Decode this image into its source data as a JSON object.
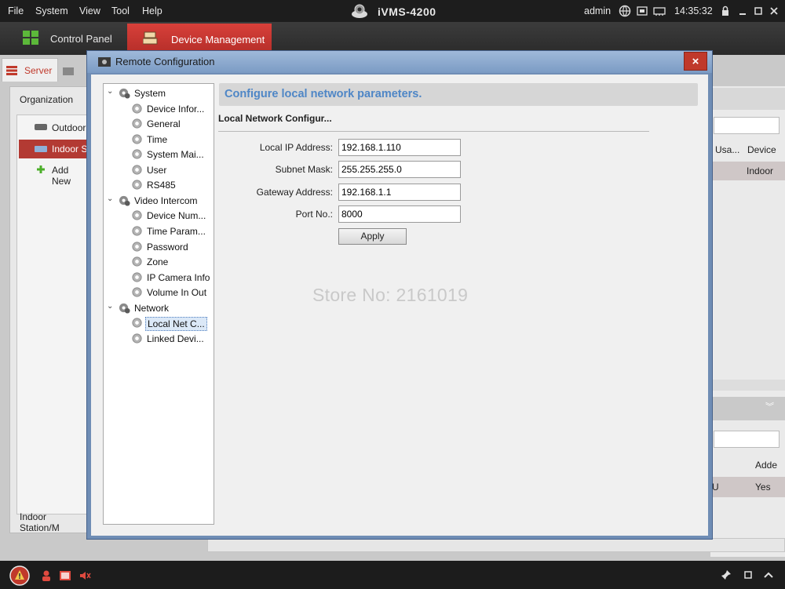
{
  "menubar": {
    "items": [
      {
        "label": "File"
      },
      {
        "label": "System"
      },
      {
        "label": "View"
      },
      {
        "label": "Tool"
      },
      {
        "label": "Help"
      }
    ],
    "app_title": "iVMS-4200",
    "user": "admin",
    "time": "14:35:32"
  },
  "tabs": {
    "control_panel": "Control Panel",
    "device_management": "Device Management"
  },
  "background": {
    "server_tab": "Server",
    "organization": "Organization",
    "org_items": [
      "Outdoor",
      "Indoor S",
      "Add New"
    ],
    "bottom_label": "Indoor Station/M",
    "col_usage": "Usa...",
    "col_device": "Device",
    "cell_indoor": "Indoor",
    "col_added": "Adde",
    "cell_u": "U",
    "cell_yes": "Yes"
  },
  "dialog": {
    "title": "Remote Configuration",
    "close": "×",
    "tree": [
      {
        "label": "System",
        "level": 0
      },
      {
        "label": "Device Infor...",
        "level": 1
      },
      {
        "label": "General",
        "level": 1
      },
      {
        "label": "Time",
        "level": 1
      },
      {
        "label": "System Mai...",
        "level": 1
      },
      {
        "label": "User",
        "level": 1
      },
      {
        "label": "RS485",
        "level": 1
      },
      {
        "label": "Video Intercom",
        "level": 0
      },
      {
        "label": "Device Num...",
        "level": 1
      },
      {
        "label": "Time Param...",
        "level": 1
      },
      {
        "label": "Password",
        "level": 1
      },
      {
        "label": "Zone",
        "level": 1
      },
      {
        "label": "IP Camera Info",
        "level": 1
      },
      {
        "label": "Volume In Out",
        "level": 1
      },
      {
        "label": "Network",
        "level": 0
      },
      {
        "label": "Local Net C...",
        "level": 1,
        "selected": true
      },
      {
        "label": "Linked Devi...",
        "level": 1
      }
    ],
    "header": "Configure local network parameters.",
    "section_title": "Local Network Configur...",
    "fields": {
      "local_ip_label": "Local IP Address:",
      "local_ip_value": "192.168.1.110",
      "subnet_label": "Subnet Mask:",
      "subnet_value": "255.255.255.0",
      "gateway_label": "Gateway Address:",
      "gateway_value": "192.168.1.1",
      "port_label": "Port No.:",
      "port_value": "8000"
    },
    "apply_label": "Apply",
    "watermark": "Store No: 2161019"
  },
  "colors": {
    "accent_red": "#c0392b",
    "header_blue": "#4e86c6",
    "dialog_frame": "#6f8db5"
  }
}
